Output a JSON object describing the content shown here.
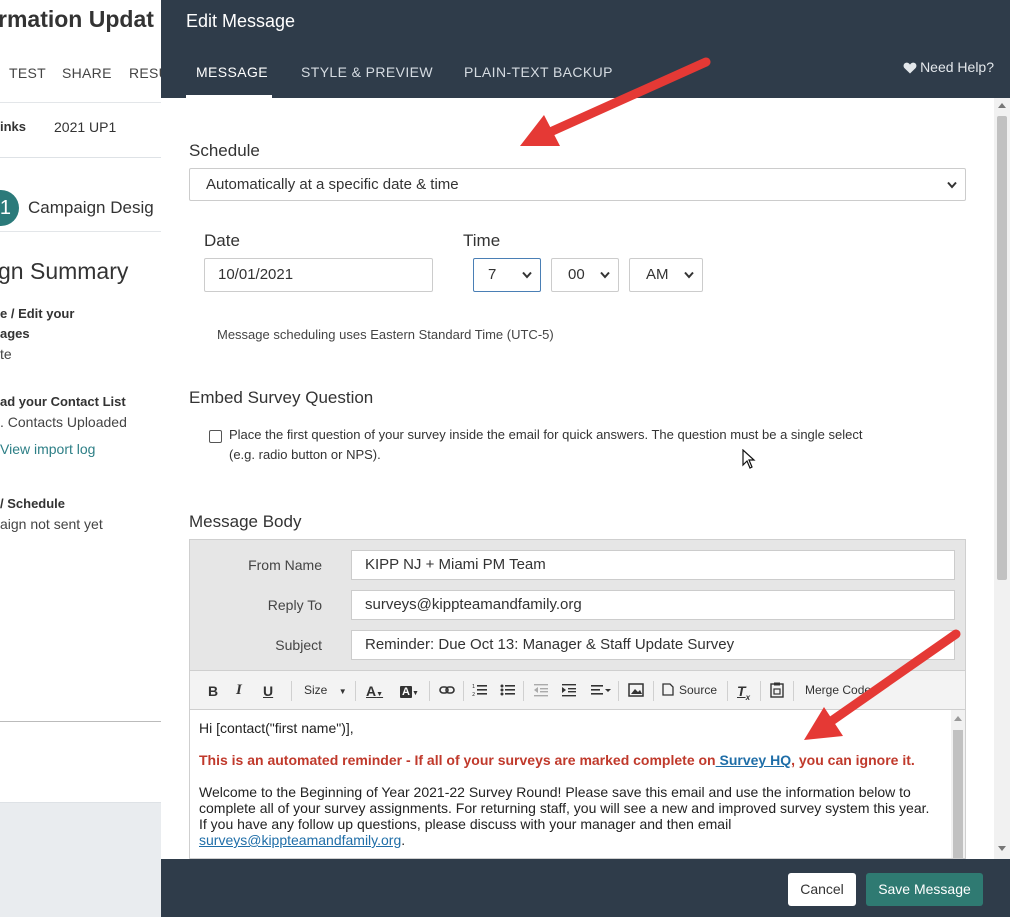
{
  "background": {
    "page_title": "rmation Updat",
    "tabs": [
      "TEST",
      "SHARE",
      "RESU"
    ],
    "subrow_left": "inks",
    "subrow_code": "2021 UP1",
    "step_number": "1",
    "step_label": "Campaign Desig",
    "summary_title": "gn Summary",
    "item1_line1": "e / Edit your",
    "item1_line2": "ages",
    "item1_status": "te",
    "item2_title": "ad your Contact List",
    "item2_status": ". Contacts Uploaded",
    "item2_link": "View import log",
    "item3_title": "/ Schedule",
    "item3_status": "aign not sent yet"
  },
  "modal": {
    "title": "Edit Message",
    "tabs": [
      {
        "label": "MESSAGE",
        "active": true
      },
      {
        "label": "STYLE & PREVIEW",
        "active": false
      },
      {
        "label": "PLAIN-TEXT BACKUP",
        "active": false
      }
    ],
    "help_label": "Need Help?",
    "schedule": {
      "heading": "Schedule",
      "mode": "Automatically at a specific date & time",
      "date_label": "Date",
      "date_value": "10/01/2021",
      "time_label": "Time",
      "hour": "7",
      "minute": "00",
      "ampm": "AM",
      "timezone_note": "Message scheduling uses Eastern Standard Time (UTC-5)"
    },
    "embed": {
      "heading": "Embed Survey Question",
      "checkbox_checked": false,
      "line1": "Place the first question of your survey inside the email for quick answers. The question must be a single select",
      "line2": "(e.g. radio button or NPS)."
    },
    "message_body": {
      "heading": "Message Body",
      "from_label": "From Name",
      "from_value": "KIPP NJ + Miami PM Team",
      "reply_label": "Reply To",
      "reply_value": "surveys@kippteamandfamily.org",
      "subject_label": "Subject",
      "subject_value": "Reminder: Due Oct 13: Manager & Staff Update Survey",
      "toolbar": {
        "bold": "B",
        "italic": "I",
        "underline": "U",
        "size": "Size",
        "font_color": "A",
        "bg_color": "A",
        "source": "Source",
        "remove_format": "T",
        "merge_codes": "Merge Codes"
      },
      "editor": {
        "greeting": "Hi [contact(\"first name\")],",
        "reminder_pre": "This is an automated reminder - If all of your surveys are marked complete on",
        "reminder_link": " Survey HQ",
        "reminder_post": ", you can ignore it.",
        "para_line1": "Welcome to the Beginning of Year 2021-22 Survey Round! Please save this email and use the information below to",
        "para_line2": "complete all of your survey assignments. For returning staff, you will see a new and improved survey system this year.",
        "para_line3": "If you have any follow up questions, please discuss with your manager and then email",
        "email_link": "surveys@kippteamandfamily.org",
        "email_post": "."
      }
    },
    "footer": {
      "cancel_label": "Cancel",
      "save_label": "Save Message"
    }
  },
  "colors": {
    "modal_header": "#2f3c4a",
    "accent_teal": "#2f7a72",
    "annotation_arrow": "#e53935",
    "reminder_red": "#c0392b",
    "link_blue": "#1f6ea8"
  }
}
